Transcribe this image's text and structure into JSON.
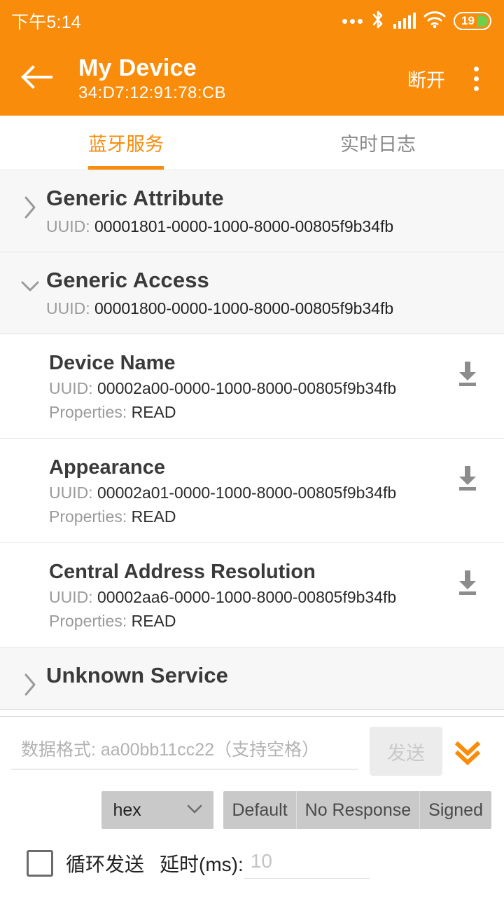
{
  "status_bar": {
    "time": "下午5:14",
    "icons": [
      "more-dots-icon",
      "bluetooth-icon",
      "cellular-signal-icon",
      "wifi-icon",
      "battery-icon"
    ],
    "battery_percent": "19"
  },
  "app_bar": {
    "back_icon": "back-arrow-icon",
    "title": "My Device",
    "subtitle": "34:D7:12:91:78:CB",
    "disconnect_label": "断开",
    "overflow_icon": "overflow-menu-icon",
    "background_color": "#F98C0A"
  },
  "tabs": [
    {
      "label": "蓝牙服务",
      "active": true
    },
    {
      "label": "实时日志",
      "active": false
    }
  ],
  "list": {
    "uuid_label": "UUID:",
    "properties_label": "Properties:",
    "services": [
      {
        "name": "Generic Attribute",
        "uuid": "00001801-0000-1000-8000-00805f9b34fb",
        "expanded": false,
        "chevron": "chevron-right-icon",
        "characteristics": []
      },
      {
        "name": "Generic Access",
        "uuid": "00001800-0000-1000-8000-00805f9b34fb",
        "expanded": true,
        "chevron": "chevron-down-icon",
        "characteristics": [
          {
            "name": "Device Name",
            "uuid": "00002a00-0000-1000-8000-00805f9b34fb",
            "properties": "READ",
            "action_icon": "download-icon"
          },
          {
            "name": "Appearance",
            "uuid": "00002a01-0000-1000-8000-00805f9b34fb",
            "properties": "READ",
            "action_icon": "download-icon"
          },
          {
            "name": "Central Address Resolution",
            "uuid": "00002aa6-0000-1000-8000-00805f9b34fb",
            "properties": "READ",
            "action_icon": "download-icon"
          }
        ]
      },
      {
        "name": "Unknown Service",
        "uuid": "",
        "expanded": false,
        "chevron": "chevron-right-icon",
        "characteristics": []
      }
    ]
  },
  "bottom_panel": {
    "data_input_placeholder": "数据格式: aa00bb11cc22（支持空格）",
    "data_input_value": "",
    "send_label": "发送",
    "send_disabled": true,
    "expand_icon": "double-chevron-down-icon",
    "format_select": {
      "value": "hex",
      "chevron": "chevron-down-icon"
    },
    "write_modes": [
      {
        "label": "Default",
        "selected": false
      },
      {
        "label": "No Response",
        "selected": false
      },
      {
        "label": "Signed",
        "selected": false
      }
    ],
    "loop_send_label": "循环发送",
    "loop_send_checked": false,
    "delay_label": "延时(ms):",
    "delay_placeholder": "10",
    "delay_value": ""
  },
  "colors": {
    "accent": "#F98C0A",
    "service_row_bg": "#F7F7F7",
    "disabled_gray": "#ECECEC",
    "control_gray": "#C9C9C9",
    "battery_green": "#6ED04A"
  }
}
